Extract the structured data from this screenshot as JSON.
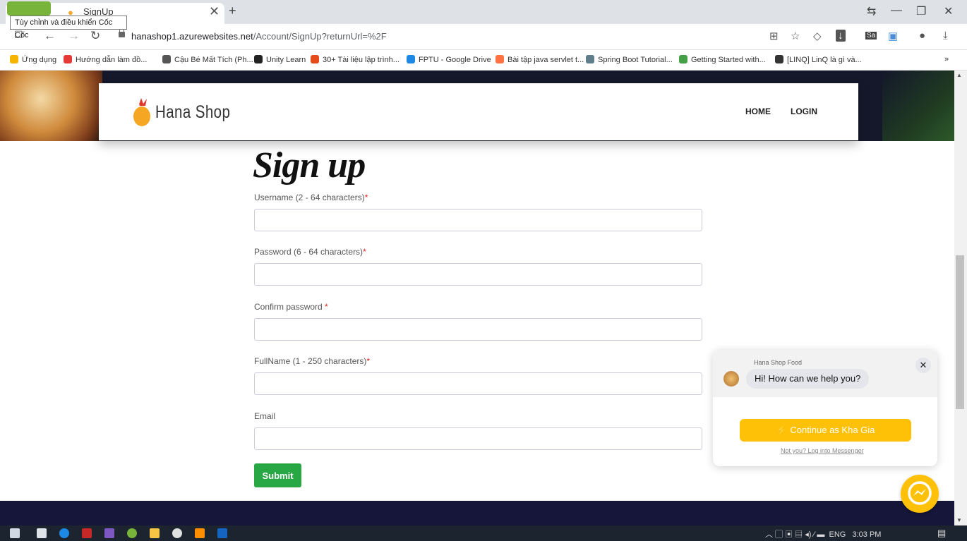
{
  "browser": {
    "tab_title": "SignUp",
    "tooltip": "Tùy chỉnh và điều khiển Cốc Cốc",
    "url_host": "hanashop1.azurewebsites.net",
    "url_path": "/Account/SignUp?returnUrl=%2F",
    "bookmarks": [
      {
        "label": "Ứng dụng",
        "color": "#f4b400"
      },
      {
        "label": "Hướng dẫn làm đồ...",
        "color": "#e53935"
      },
      {
        "label": "Cậu Bé Mất Tích (Ph...",
        "color": "#555555"
      },
      {
        "label": "Unity Learn",
        "color": "#222222"
      },
      {
        "label": "30+ Tài liệu lập trình...",
        "color": "#e64a19"
      },
      {
        "label": "FPTU - Google Drive",
        "color": "#1e88e5"
      },
      {
        "label": "Bài tập java servlet t...",
        "color": "#ff7043"
      },
      {
        "label": "Spring Boot Tutorial...",
        "color": "#607d8b"
      },
      {
        "label": "Getting Started with...",
        "color": "#43a047"
      },
      {
        "label": "[LINQ] LinQ là gì và...",
        "color": "#333333"
      }
    ],
    "bookmarks_more": "»"
  },
  "site": {
    "brand": "Hana Shop",
    "nav": {
      "home": "HOME",
      "login": "LOGIN"
    }
  },
  "form": {
    "heading": "Sign up",
    "fields": [
      {
        "label": "Username (2 - 64 characters)",
        "required": "*",
        "value": ""
      },
      {
        "label": "Password (6 - 64 characters)",
        "required": "*",
        "value": ""
      },
      {
        "label": "Confirm password ",
        "required": "*",
        "value": ""
      },
      {
        "label": "FullName (1 - 250 characters)",
        "required": "*",
        "value": ""
      },
      {
        "label": "Email",
        "required": "",
        "value": ""
      }
    ],
    "submit": "Submit"
  },
  "chat": {
    "page_name": "Hana Shop Food",
    "greeting": "Hi! How can we help you?",
    "continue_label": "Continue as Kha Gia",
    "not_you": "Not you? Log into Messenger"
  },
  "taskbar": {
    "lang": "ENG",
    "time": "3:03 PM"
  },
  "colors": {
    "accent_green": "#28a745",
    "messenger_yellow": "#ffc107",
    "hero_dark": "#14182a"
  }
}
